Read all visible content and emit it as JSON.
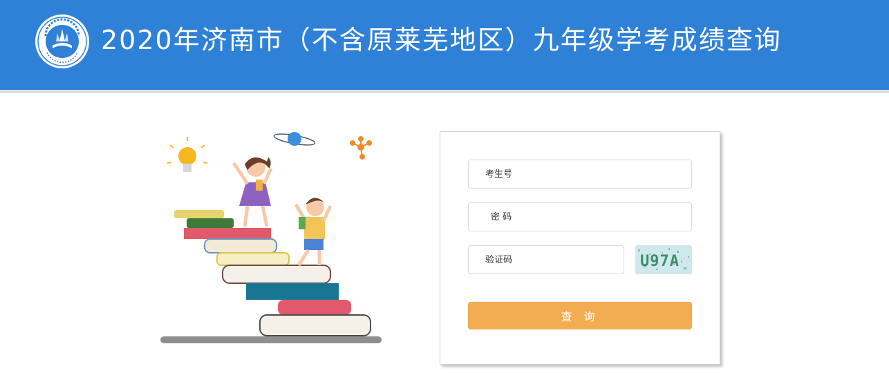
{
  "header": {
    "title": "2020年济南市（不含原莱芜地区）九年级学考成绩查询",
    "background_color": "#2f81d8",
    "logo_icon": "education-bureau-logo"
  },
  "illustration": {
    "description_icon": "students-on-books-illustration"
  },
  "form": {
    "exam_number": {
      "placeholder": "考生号",
      "value": ""
    },
    "password": {
      "placeholder": "密 码",
      "value": ""
    },
    "captcha": {
      "placeholder": "验证码",
      "value": "",
      "image_text": "U97A"
    },
    "submit_label": "查 询",
    "submit_color": "#f2ac51"
  }
}
